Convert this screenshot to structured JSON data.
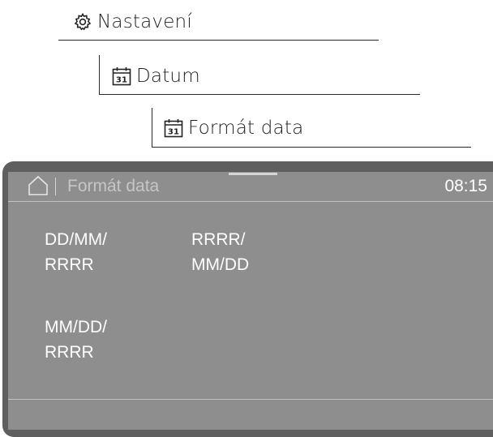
{
  "breadcrumb": {
    "items": [
      {
        "label": "Nastavení",
        "icon": "gear-icon"
      },
      {
        "label": "Datum",
        "icon": "calendar-icon",
        "icon_text": "31"
      },
      {
        "label": "Formát data",
        "icon": "calendar-icon",
        "icon_text": "31"
      }
    ]
  },
  "display": {
    "title": "Formát data",
    "time": "08:15",
    "home_icon": "home-icon",
    "options": [
      {
        "line1": "DD/MM/",
        "line2": "RRRR"
      },
      {
        "line1": "RRRR/",
        "line2": "MM/DD"
      },
      {
        "line1": "MM/DD/",
        "line2": "RRRR"
      }
    ]
  },
  "colors": {
    "screen_background": "#8e8e8e",
    "device_frame": "#5f5f5f",
    "text_on_screen": "#ffffff",
    "title_text": "#c6c6c6"
  }
}
